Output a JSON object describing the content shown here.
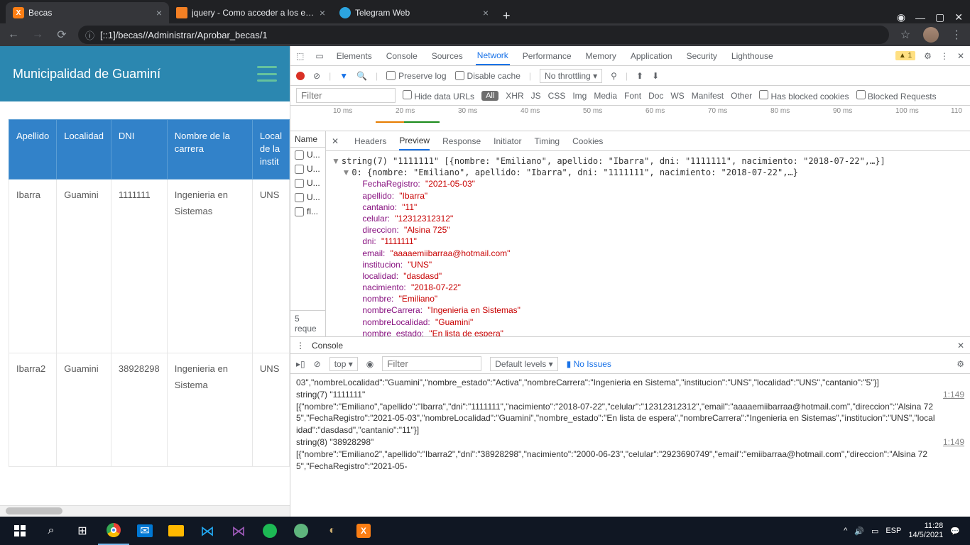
{
  "browser": {
    "tabs": [
      {
        "title": "Becas",
        "active": true
      },
      {
        "title": "jquery - Como acceder a los elem",
        "active": false
      },
      {
        "title": "Telegram Web",
        "active": false
      }
    ],
    "url_display": "[::1]/becas//Administrar/Aprobar_becas/1"
  },
  "page": {
    "title": "Municipalidad de Guaminí",
    "table": {
      "headers": [
        "Apellido",
        "Localidad",
        "DNI",
        "Nombre de la carrera",
        "Localidad de la institución"
      ],
      "rows": [
        {
          "apellido": "Ibarra",
          "localidad": "Guamini",
          "dni": "1111111",
          "carrera": "Ingenieria en Sistemas",
          "inst": "UNS"
        },
        {
          "apellido": "Ibarra2",
          "localidad": "Guamini",
          "dni": "38928298",
          "carrera": "Ingenieria en Sistema",
          "inst": "UNS"
        }
      ]
    }
  },
  "devtools": {
    "main_tabs": [
      "Elements",
      "Console",
      "Sources",
      "Network",
      "Performance",
      "Memory",
      "Application",
      "Security",
      "Lighthouse"
    ],
    "active_main_tab": "Network",
    "warning_count": "1",
    "controls": {
      "preserve_log": "Preserve log",
      "disable_cache": "Disable cache",
      "throttling": "No throttling"
    },
    "filter": {
      "placeholder": "Filter",
      "hide_data_urls": "Hide data URLs",
      "all": "All",
      "types": [
        "XHR",
        "JS",
        "CSS",
        "Img",
        "Media",
        "Font",
        "Doc",
        "WS",
        "Manifest",
        "Other"
      ],
      "has_blocked_cookies": "Has blocked cookies",
      "blocked_requests": "Blocked Requests"
    },
    "timeline_ticks": [
      "10 ms",
      "20 ms",
      "30 ms",
      "40 ms",
      "50 ms",
      "60 ms",
      "70 ms",
      "80 ms",
      "90 ms",
      "100 ms",
      "110"
    ],
    "request_list": {
      "header": "Name",
      "items": [
        "U...",
        "U...",
        "U...",
        "U...",
        "fl..."
      ],
      "footer": "5 reque"
    },
    "detail_tabs": [
      "Headers",
      "Preview",
      "Response",
      "Initiator",
      "Timing",
      "Cookies"
    ],
    "active_detail_tab": "Preview",
    "preview_top": "string(7) \"1111111\" [{nombre: \"Emiliano\", apellido: \"Ibarra\", dni: \"1111111\", nacimiento: \"2018-07-22\",…}]",
    "preview_sub": "0: {nombre: \"Emiliano\", apellido: \"Ibarra\", dni: \"1111111\", nacimiento: \"2018-07-22\",…}",
    "preview_fields": [
      {
        "k": "FechaRegistro",
        "v": "\"2021-05-03\""
      },
      {
        "k": "apellido",
        "v": "\"Ibarra\""
      },
      {
        "k": "cantanio",
        "v": "\"11\""
      },
      {
        "k": "celular",
        "v": "\"12312312312\""
      },
      {
        "k": "direccion",
        "v": "\"Alsina 725\""
      },
      {
        "k": "dni",
        "v": "\"1111111\""
      },
      {
        "k": "email",
        "v": "\"aaaaemiibarraa@hotmail.com\""
      },
      {
        "k": "institucion",
        "v": "\"UNS\""
      },
      {
        "k": "localidad",
        "v": "\"dasdasd\""
      },
      {
        "k": "nacimiento",
        "v": "\"2018-07-22\""
      },
      {
        "k": "nombre",
        "v": "\"Emiliano\""
      },
      {
        "k": "nombreCarrera",
        "v": "\"Ingenieria en Sistemas\""
      },
      {
        "k": "nombreLocalidad",
        "v": "\"Guamini\""
      },
      {
        "k": "nombre_estado",
        "v": "\"En lista de espera\""
      }
    ],
    "console": {
      "label": "Console",
      "context": "top",
      "filter_placeholder": "Filter",
      "levels": "Default levels ▾",
      "no_issues": "No Issues",
      "lines": [
        {
          "msg": "03\",\"nombreLocalidad\":\"Guamini\",\"nombre_estado\":\"Activa\",\"nombreCarrera\":\"Ingenieria en Sistema\",\"institucion\":\"UNS\",\"localidad\":\"UNS\",\"cantanio\":\"5\"}]",
          "src": ""
        },
        {
          "msg": "string(7) \"1111111\"\n[{\"nombre\":\"Emiliano\",\"apellido\":\"Ibarra\",\"dni\":\"1111111\",\"nacimiento\":\"2018-07-22\",\"celular\":\"12312312312\",\"email\":\"aaaaemiibarraa@hotmail.com\",\"direccion\":\"Alsina 725\",\"FechaRegistro\":\"2021-05-03\",\"nombreLocalidad\":\"Guamini\",\"nombre_estado\":\"En lista de espera\",\"nombreCarrera\":\"Ingenieria en Sistemas\",\"institucion\":\"UNS\",\"localidad\":\"dasdasd\",\"cantanio\":\"11\"}]",
          "src": "1:149"
        },
        {
          "msg": "string(8) \"38928298\"\n[{\"nombre\":\"Emiliano2\",\"apellido\":\"Ibarra2\",\"dni\":\"38928298\",\"nacimiento\":\"2000-06-23\",\"celular\":\"2923690749\",\"email\":\"emiibarraa@hotmail.com\",\"direccion\":\"Alsina 725\",\"FechaRegistro\":\"2021-05-",
          "src": "1:149"
        }
      ]
    }
  },
  "taskbar": {
    "lang": "ESP",
    "time": "11:28",
    "date": "14/5/2021"
  }
}
